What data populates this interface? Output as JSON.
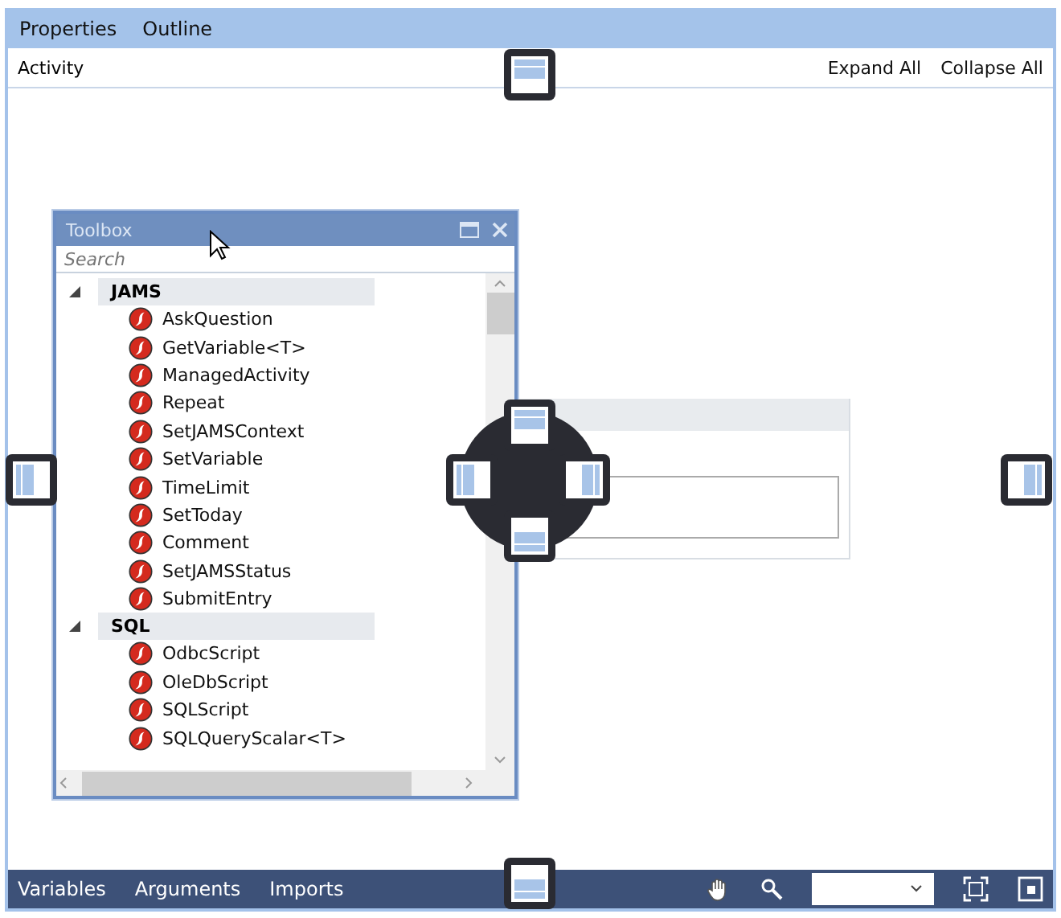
{
  "top_tabs": [
    {
      "label": "Properties"
    },
    {
      "label": "Outline"
    }
  ],
  "header": {
    "title": "Activity",
    "actions": [
      "Expand All",
      "Collapse All"
    ]
  },
  "toolbox": {
    "title": "Toolbox",
    "search": {
      "placeholder": "Search"
    },
    "categories": [
      {
        "name": "JAMS",
        "expanded": true,
        "items": [
          "AskQuestion",
          "GetVariable<T>",
          "ManagedActivity",
          "Repeat",
          "SetJAMSContext",
          "SetVariable",
          "TimeLimit",
          "SetToday",
          "Comment",
          "SetJAMSStatus",
          "SubmitEntry"
        ]
      },
      {
        "name": "SQL",
        "expanded": true,
        "items": [
          "OdbcScript",
          "OleDbScript",
          "SQLScript",
          "SQLQueryScalar<T>"
        ]
      }
    ]
  },
  "bottom_tabs": [
    {
      "label": "Variables"
    },
    {
      "label": "Arguments"
    },
    {
      "label": "Imports"
    }
  ]
}
